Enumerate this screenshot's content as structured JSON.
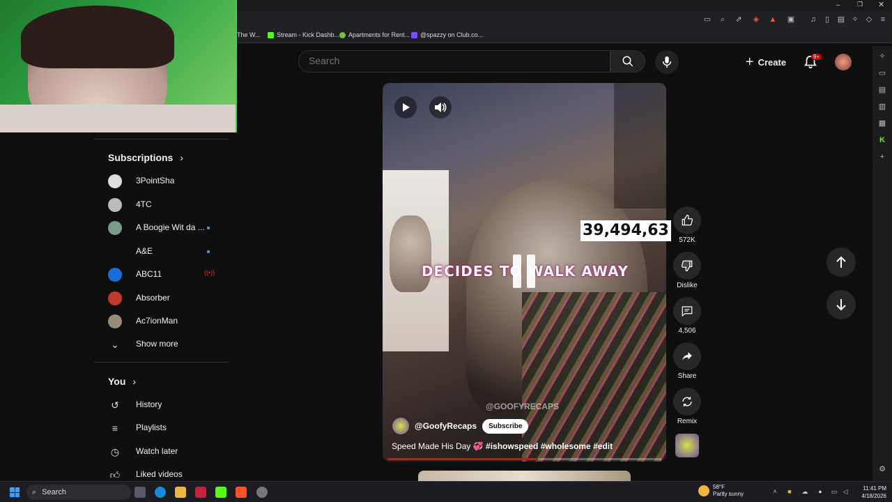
{
  "bookmarks": [
    {
      "label": "The W...",
      "color": "#888888"
    },
    {
      "label": "Stream - Kick Dashb...",
      "color": "#53fc18"
    },
    {
      "label": "Apartments for Rent...",
      "color": "#6fbf40"
    },
    {
      "label": "@spazzy on Club.co...",
      "color": "#7b4fff"
    }
  ],
  "header": {
    "search_placeholder": "Search",
    "create_label": "Create",
    "notification_badge": "9+"
  },
  "sidebar": {
    "subscriptions_title": "Subscriptions",
    "subscriptions": [
      {
        "label": "3PointSha",
        "color": "#dddddd",
        "indicator": ""
      },
      {
        "label": "4TC",
        "color": "#bbbbbb",
        "indicator": ""
      },
      {
        "label": "A Boogie Wit da ...",
        "color": "#7a9a8a",
        "indicator": "dot"
      },
      {
        "label": "A&E",
        "color": "#0f0f0f",
        "indicator": "dot"
      },
      {
        "label": "ABC11",
        "color": "#1e6bd6",
        "indicator": "live"
      },
      {
        "label": "Absorber",
        "color": "#c0392b",
        "indicator": ""
      },
      {
        "label": "Ac7ionMan",
        "color": "#9a8a7a",
        "indicator": ""
      }
    ],
    "show_more_label": "Show more",
    "you_title": "You",
    "you_items": [
      {
        "label": "History",
        "icon": "history-icon"
      },
      {
        "label": "Playlists",
        "icon": "playlists-icon"
      },
      {
        "label": "Watch later",
        "icon": "watch-later-icon"
      },
      {
        "label": "Liked videos",
        "icon": "liked-videos-icon"
      }
    ]
  },
  "video": {
    "overlay_text": "DECIDES TO WALK AWAY",
    "counter": "39,494,63",
    "watermark": "@GOOFYRECAPS",
    "channel": "@GoofyRecaps",
    "subscribe_label": "Subscribe",
    "title": "Speed Made His Day 💞",
    "hashtags": "#ishowspeed #wholesome #edit",
    "progress": 0.55
  },
  "actions": {
    "like_count": "572K",
    "dislike_label": "Dislike",
    "comments_count": "4,506",
    "share_label": "Share",
    "remix_label": "Remix"
  },
  "taskbar": {
    "search_label": "Search",
    "weather_temp": "58°F",
    "weather_desc": "Partly sunny",
    "time": "11:41 PM",
    "date": "4/18/2026"
  },
  "colors": {
    "accent_red": "#ff0000",
    "background": "#0f0f0f"
  }
}
